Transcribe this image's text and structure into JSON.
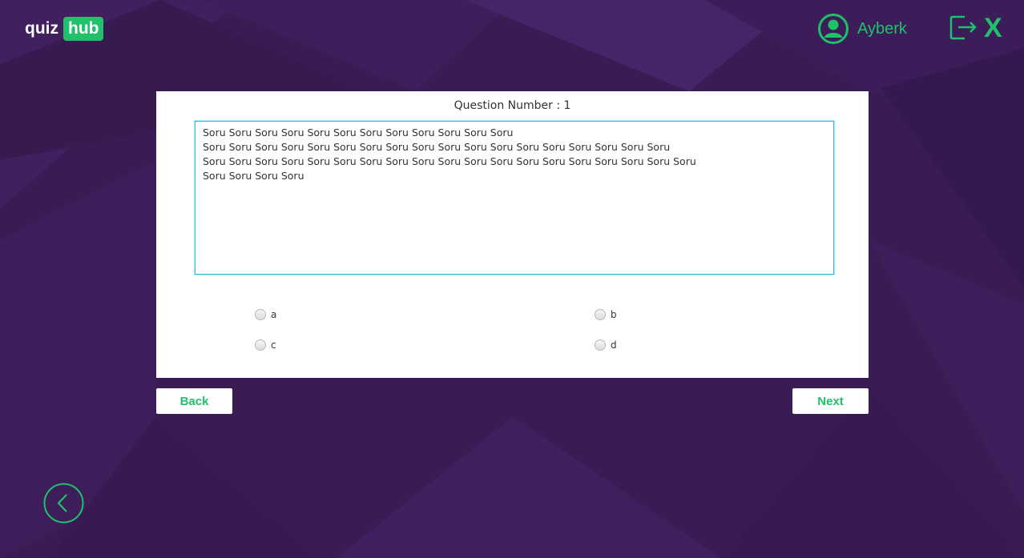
{
  "brand": {
    "part1": "quiz",
    "part2": "hub"
  },
  "user": {
    "name": "Ayberk",
    "icon": "user-avatar-icon"
  },
  "header": {
    "logout_icon": "logout-icon",
    "close_label": "X"
  },
  "question": {
    "number_label": "Question Number : 1",
    "lines": [
      "Soru Soru Soru Soru Soru Soru Soru Soru Soru Soru Soru Soru",
      "Soru Soru Soru Soru Soru Soru Soru Soru Soru Soru Soru Soru Soru Soru Soru Soru Soru Soru",
      "Soru Soru Soru Soru Soru Soru Soru Soru Soru Soru Soru Soru Soru Soru Soru Soru Soru Soru Soru",
      "Soru Soru Soru Soru"
    ]
  },
  "options": [
    {
      "label": "a",
      "selected": false
    },
    {
      "label": "b",
      "selected": false
    },
    {
      "label": "c",
      "selected": false
    },
    {
      "label": "d",
      "selected": false
    }
  ],
  "nav": {
    "back_label": "Back",
    "next_label": "Next",
    "back_circle_icon": "chevron-left-icon"
  },
  "colors": {
    "accent": "#1fc16b",
    "background": "#3a1c55",
    "focus_border": "#2fb7dd"
  }
}
